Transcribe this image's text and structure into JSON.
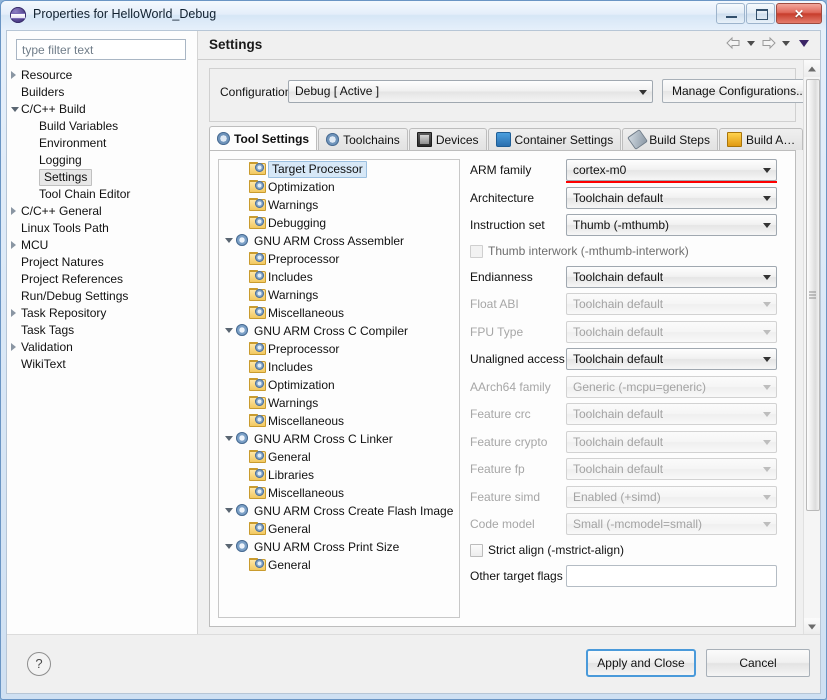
{
  "window": {
    "title": "Properties for HelloWorld_Debug",
    "icon": "eclipse-icon",
    "minimize": "–",
    "restore": "❐",
    "close": "✕"
  },
  "filter": {
    "placeholder": "type filter text",
    "value": ""
  },
  "nav": {
    "items": [
      {
        "label": "Resource",
        "indent": 0,
        "arrow": "collapsed",
        "selected": false
      },
      {
        "label": "Builders",
        "indent": 0,
        "arrow": "none",
        "selected": false
      },
      {
        "label": "C/C++ Build",
        "indent": 0,
        "arrow": "expanded",
        "selected": false
      },
      {
        "label": "Build Variables",
        "indent": 1,
        "arrow": "none",
        "selected": false
      },
      {
        "label": "Environment",
        "indent": 1,
        "arrow": "none",
        "selected": false
      },
      {
        "label": "Logging",
        "indent": 1,
        "arrow": "none",
        "selected": false
      },
      {
        "label": "Settings",
        "indent": 1,
        "arrow": "none",
        "selected": true
      },
      {
        "label": "Tool Chain Editor",
        "indent": 1,
        "arrow": "none",
        "selected": false
      },
      {
        "label": "C/C++ General",
        "indent": 0,
        "arrow": "collapsed",
        "selected": false
      },
      {
        "label": "Linux Tools Path",
        "indent": 0,
        "arrow": "none",
        "selected": false
      },
      {
        "label": "MCU",
        "indent": 0,
        "arrow": "collapsed",
        "selected": false
      },
      {
        "label": "Project Natures",
        "indent": 0,
        "arrow": "none",
        "selected": false
      },
      {
        "label": "Project References",
        "indent": 0,
        "arrow": "none",
        "selected": false
      },
      {
        "label": "Run/Debug Settings",
        "indent": 0,
        "arrow": "none",
        "selected": false
      },
      {
        "label": "Task Repository",
        "indent": 0,
        "arrow": "collapsed",
        "selected": false
      },
      {
        "label": "Task Tags",
        "indent": 0,
        "arrow": "none",
        "selected": false
      },
      {
        "label": "Validation",
        "indent": 0,
        "arrow": "collapsed",
        "selected": false
      },
      {
        "label": "WikiText",
        "indent": 0,
        "arrow": "none",
        "selected": false
      }
    ]
  },
  "pane": {
    "title": "Settings",
    "nav_back": "back-arrow",
    "nav_forward": "forward-arrow",
    "nav_menu": "view-menu-triangle"
  },
  "configuration": {
    "label": "Configuration:",
    "value": "Debug  [ Active ]",
    "manage_button": "Manage Configurations..."
  },
  "tabs": {
    "items": [
      {
        "label": "Tool Settings",
        "icon": "gear-icon",
        "active": true
      },
      {
        "label": "Toolchains",
        "icon": "gear-icon",
        "active": false
      },
      {
        "label": "Devices",
        "icon": "chip-icon",
        "active": false
      },
      {
        "label": "Container Settings",
        "icon": "container-icon",
        "active": false
      },
      {
        "label": "Build Steps",
        "icon": "wrench-icon",
        "active": false
      },
      {
        "label": "Build A…",
        "icon": "crown-icon",
        "active": false
      }
    ],
    "scroll_left": "◄",
    "scroll_right": "►"
  },
  "tool_tree": {
    "items": [
      {
        "label": "Target Processor",
        "indent": 1,
        "icon": "folder-gear-icon",
        "expandable": false,
        "selected": true
      },
      {
        "label": "Optimization",
        "indent": 1,
        "icon": "folder-gear-icon",
        "expandable": false,
        "selected": false
      },
      {
        "label": "Warnings",
        "indent": 1,
        "icon": "folder-gear-icon",
        "expandable": false,
        "selected": false
      },
      {
        "label": "Debugging",
        "indent": 1,
        "icon": "folder-gear-icon",
        "expandable": false,
        "selected": false
      },
      {
        "label": "GNU ARM Cross Assembler",
        "indent": 0,
        "icon": "gear-icon",
        "expandable": true,
        "selected": false
      },
      {
        "label": "Preprocessor",
        "indent": 1,
        "icon": "folder-gear-icon",
        "expandable": false,
        "selected": false
      },
      {
        "label": "Includes",
        "indent": 1,
        "icon": "folder-gear-icon",
        "expandable": false,
        "selected": false
      },
      {
        "label": "Warnings",
        "indent": 1,
        "icon": "folder-gear-icon",
        "expandable": false,
        "selected": false
      },
      {
        "label": "Miscellaneous",
        "indent": 1,
        "icon": "folder-gear-icon",
        "expandable": false,
        "selected": false
      },
      {
        "label": "GNU ARM Cross C Compiler",
        "indent": 0,
        "icon": "gear-icon",
        "expandable": true,
        "selected": false
      },
      {
        "label": "Preprocessor",
        "indent": 1,
        "icon": "folder-gear-icon",
        "expandable": false,
        "selected": false
      },
      {
        "label": "Includes",
        "indent": 1,
        "icon": "folder-gear-icon",
        "expandable": false,
        "selected": false
      },
      {
        "label": "Optimization",
        "indent": 1,
        "icon": "folder-gear-icon",
        "expandable": false,
        "selected": false
      },
      {
        "label": "Warnings",
        "indent": 1,
        "icon": "folder-gear-icon",
        "expandable": false,
        "selected": false
      },
      {
        "label": "Miscellaneous",
        "indent": 1,
        "icon": "folder-gear-icon",
        "expandable": false,
        "selected": false
      },
      {
        "label": "GNU ARM Cross C Linker",
        "indent": 0,
        "icon": "gear-icon",
        "expandable": true,
        "selected": false
      },
      {
        "label": "General",
        "indent": 1,
        "icon": "folder-gear-icon",
        "expandable": false,
        "selected": false
      },
      {
        "label": "Libraries",
        "indent": 1,
        "icon": "folder-gear-icon",
        "expandable": false,
        "selected": false
      },
      {
        "label": "Miscellaneous",
        "indent": 1,
        "icon": "folder-gear-icon",
        "expandable": false,
        "selected": false
      },
      {
        "label": "GNU ARM Cross Create Flash Image",
        "indent": 0,
        "icon": "gear-icon",
        "expandable": true,
        "selected": false
      },
      {
        "label": "General",
        "indent": 1,
        "icon": "folder-gear-icon",
        "expandable": false,
        "selected": false
      },
      {
        "label": "GNU ARM Cross Print Size",
        "indent": 0,
        "icon": "gear-icon",
        "expandable": true,
        "selected": false
      },
      {
        "label": "General",
        "indent": 1,
        "icon": "folder-gear-icon",
        "expandable": false,
        "selected": false
      }
    ]
  },
  "form": {
    "fields": [
      {
        "kind": "combo",
        "label": "ARM family",
        "value": "cortex-m0",
        "enabled": true,
        "error": true
      },
      {
        "kind": "combo",
        "label": "Architecture",
        "value": "Toolchain default",
        "enabled": true,
        "error": false
      },
      {
        "kind": "combo",
        "label": "Instruction set",
        "value": "Thumb (-mthumb)",
        "enabled": true,
        "error": false
      },
      {
        "kind": "checkbox",
        "label": "Thumb interwork (-mthumb-interwork)",
        "checked": false,
        "enabled": false
      },
      {
        "kind": "combo",
        "label": "Endianness",
        "value": "Toolchain default",
        "enabled": true,
        "error": false
      },
      {
        "kind": "combo",
        "label": "Float ABI",
        "value": "Toolchain default",
        "enabled": false,
        "error": false
      },
      {
        "kind": "combo",
        "label": "FPU Type",
        "value": "Toolchain default",
        "enabled": false,
        "error": false
      },
      {
        "kind": "combo",
        "label": "Unaligned access",
        "value": "Toolchain default",
        "enabled": true,
        "error": false
      },
      {
        "kind": "combo",
        "label": "AArch64 family",
        "value": "Generic (-mcpu=generic)",
        "enabled": false,
        "error": false
      },
      {
        "kind": "combo",
        "label": "Feature crc",
        "value": "Toolchain default",
        "enabled": false,
        "error": false
      },
      {
        "kind": "combo",
        "label": "Feature crypto",
        "value": "Toolchain default",
        "enabled": false,
        "error": false
      },
      {
        "kind": "combo",
        "label": "Feature fp",
        "value": "Toolchain default",
        "enabled": false,
        "error": false
      },
      {
        "kind": "combo",
        "label": "Feature simd",
        "value": "Enabled (+simd)",
        "enabled": false,
        "error": false
      },
      {
        "kind": "combo",
        "label": "Code model",
        "value": "Small (-mcmodel=small)",
        "enabled": false,
        "error": false
      },
      {
        "kind": "checkbox",
        "label": "Strict align (-mstrict-align)",
        "checked": false,
        "enabled": true
      },
      {
        "kind": "text",
        "label": "Other target flags",
        "value": "",
        "enabled": true,
        "error": false
      }
    ]
  },
  "footer": {
    "help": "?",
    "apply_and_close": "Apply and Close",
    "cancel": "Cancel"
  }
}
